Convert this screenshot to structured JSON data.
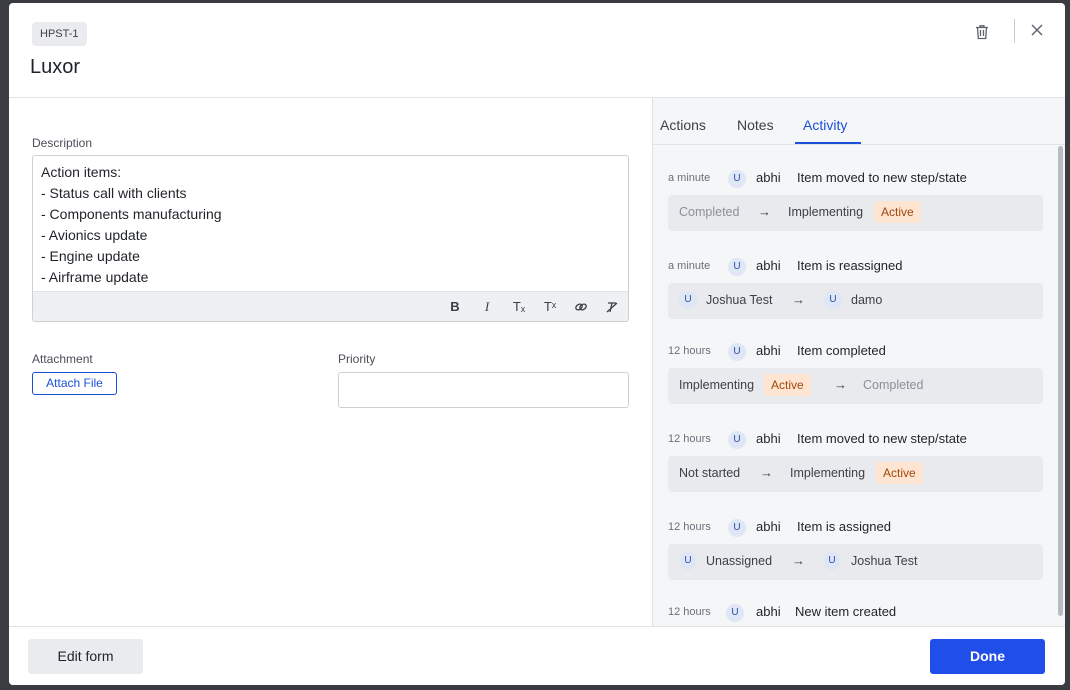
{
  "header": {
    "badge": "HPST-1",
    "title": "Luxor"
  },
  "form": {
    "description_label": "Description",
    "description_lines": [
      "Action items:",
      "- Status call with clients",
      "- Components manufacturing",
      "- Avionics update",
      "- Engine update",
      "- Airframe update"
    ],
    "toolbar": [
      "B",
      "I",
      "Tₓ",
      "Tˣ",
      "link",
      "clear-format"
    ],
    "attachment_label": "Attachment",
    "attach_button": "Attach File",
    "priority_label": "Priority",
    "priority_value": ""
  },
  "tabs": [
    {
      "label": "Actions",
      "active": false
    },
    {
      "label": "Notes",
      "active": false
    },
    {
      "label": "Activity",
      "active": true
    }
  ],
  "activity": [
    {
      "time": "a minute",
      "avatar": "U",
      "user": "abhi",
      "text": "Item moved to new step/state",
      "from": "Completed",
      "to": "Implementing",
      "to_pill": "Active"
    },
    {
      "time": "a minute",
      "avatar": "U",
      "user": "abhi",
      "text": "Item is reassigned",
      "from_avatar": "U",
      "from": "Joshua Test",
      "to_avatar": "U",
      "to": "damo"
    },
    {
      "time": "12 hours",
      "avatar": "U",
      "user": "abhi",
      "text": "Item completed",
      "from": "Implementing",
      "from_pill": "Active",
      "to": "Completed"
    },
    {
      "time": "12 hours",
      "avatar": "U",
      "user": "abhi",
      "text": "Item moved to new step/state",
      "from": "Not started",
      "to": "Implementing",
      "to_pill": "Active"
    },
    {
      "time": "12 hours",
      "avatar": "U",
      "user": "abhi",
      "text": "Item is assigned",
      "from_avatar": "U",
      "from": "Unassigned",
      "to_avatar": "U",
      "to": "Joshua Test"
    },
    {
      "time": "12 hours",
      "avatar": "U",
      "user": "abhi",
      "text": "New item created"
    }
  ],
  "footer": {
    "edit_form": "Edit form",
    "done": "Done"
  },
  "colors": {
    "accent": "#1f4fe8",
    "active_pill_bg": "#fde5d2",
    "active_pill_text": "#a1460f"
  },
  "icons": {
    "trash": "trash-icon",
    "close": "close-icon",
    "arrow": "arrow-right-icon"
  }
}
